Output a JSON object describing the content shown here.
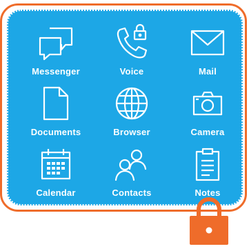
{
  "apps": [
    {
      "label": "Messenger",
      "icon": "chat-bubbles-icon"
    },
    {
      "label": "Voice",
      "icon": "phone-lock-icon"
    },
    {
      "label": "Mail",
      "icon": "envelope-icon"
    },
    {
      "label": "Documents",
      "icon": "document-icon"
    },
    {
      "label": "Browser",
      "icon": "globe-icon"
    },
    {
      "label": "Camera",
      "icon": "camera-icon"
    },
    {
      "label": "Calendar",
      "icon": "calendar-icon"
    },
    {
      "label": "Contacts",
      "icon": "contacts-icon"
    },
    {
      "label": "Notes",
      "icon": "clipboard-icon"
    }
  ],
  "colors": {
    "panel": "#1da7e6",
    "frame": "#ef6c2a",
    "lock": "#ef6c2a",
    "icon_stroke": "#ffffff"
  }
}
